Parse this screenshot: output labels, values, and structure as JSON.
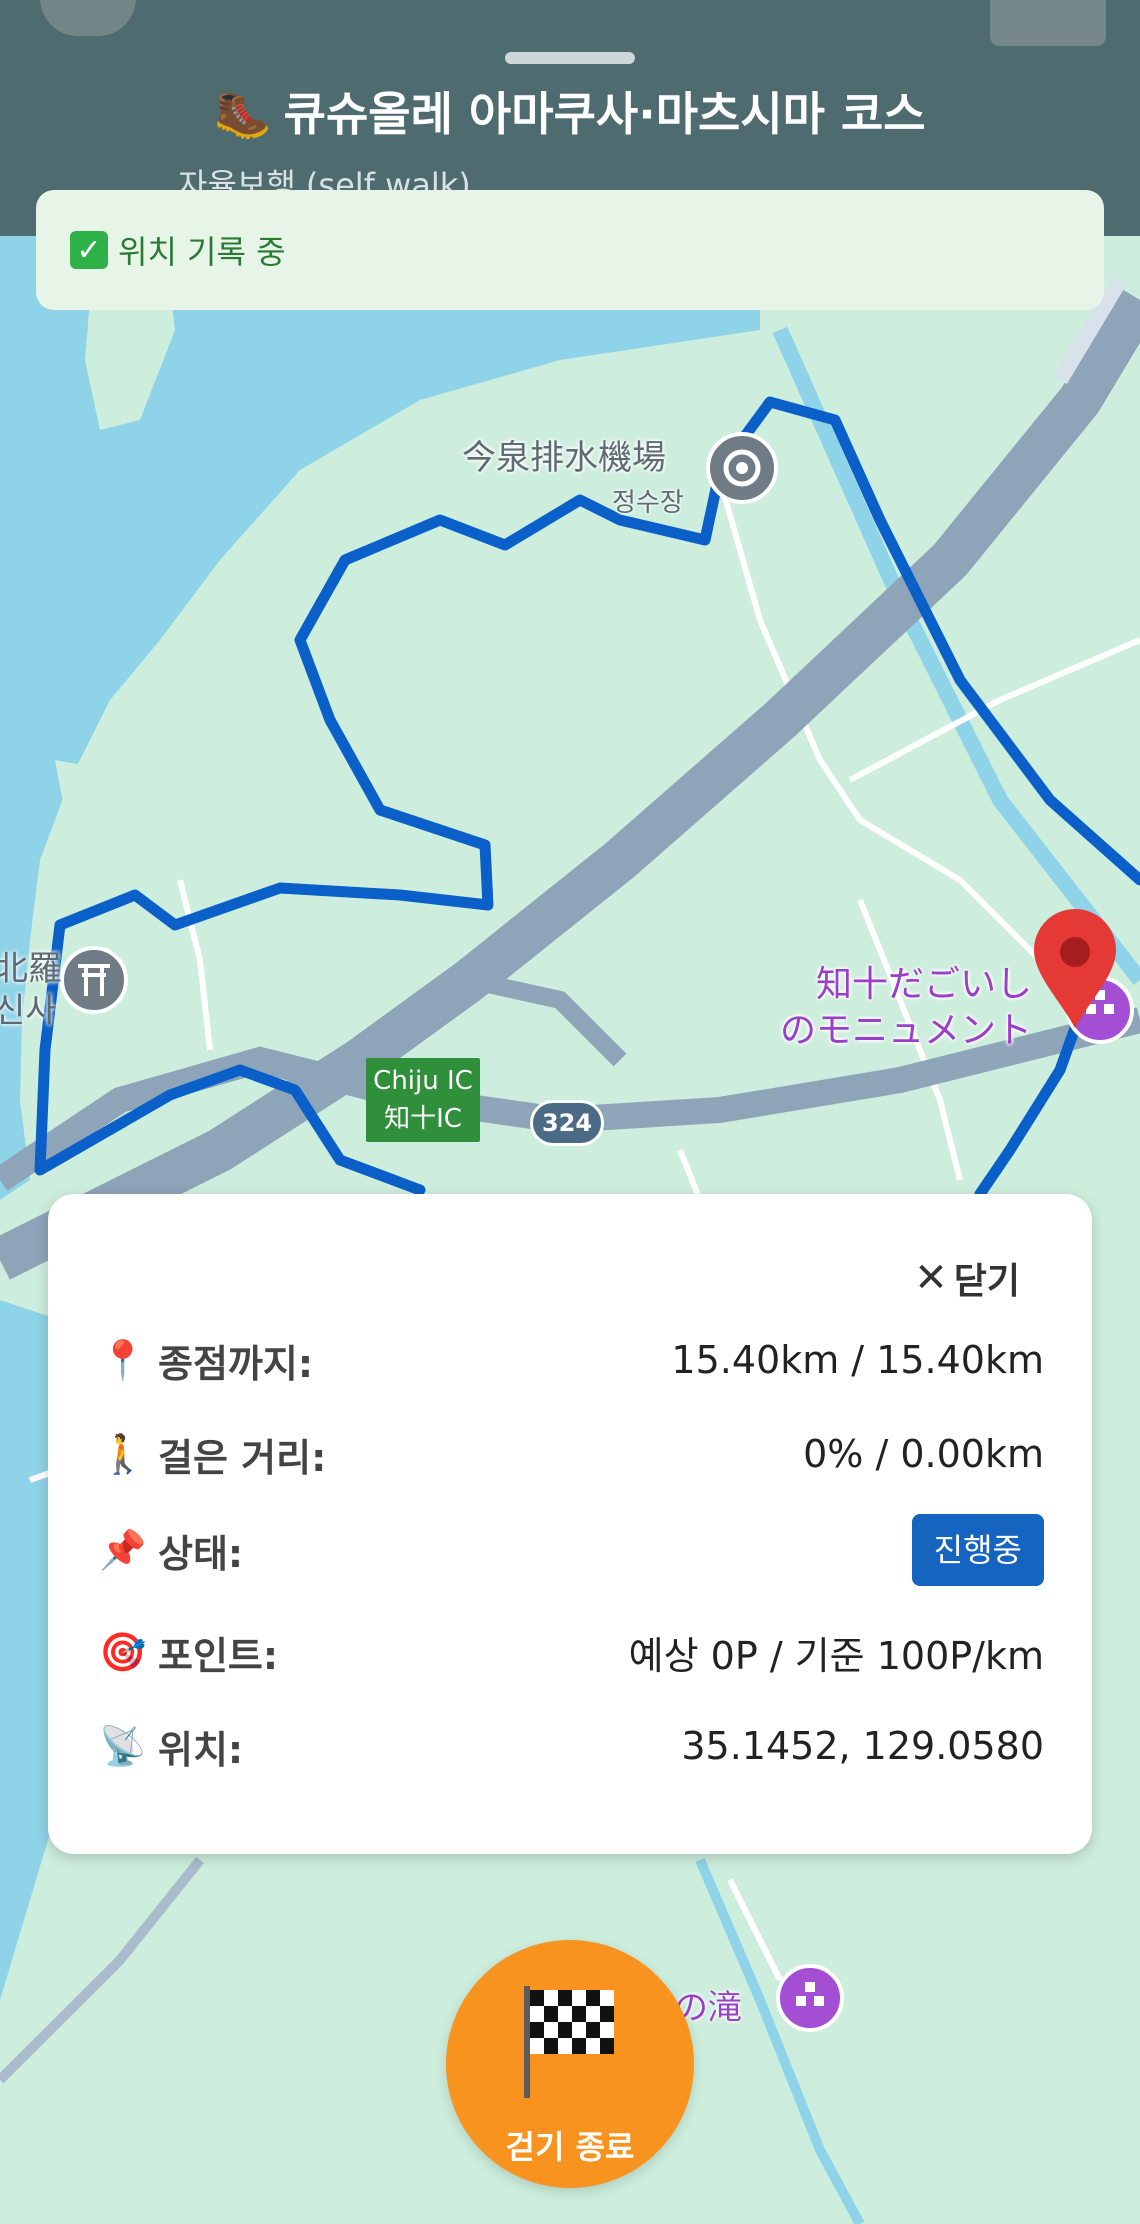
{
  "header": {
    "title": "큐슈올레 아마쿠사·마츠시마 코스",
    "subtitle": "자율보행 (self walk)",
    "title_icon": "boot-icon"
  },
  "status_banner": {
    "text": "위치 기록 중",
    "icon": "check-box-icon"
  },
  "map": {
    "labels": {
      "pumping_station": "今泉排水機場",
      "pumping_station_sub": "정수장",
      "monument_line1": "知十だごいし",
      "monument_line2": "のモニュメント",
      "shrine_line1": "北羅",
      "shrine_line2": "신사",
      "ic_line1": "Chiju IC",
      "ic_line2": "知十IC",
      "route_number": "324",
      "waterfall": "水の滝"
    },
    "colors": {
      "water": "#8fd3e8",
      "land": "#cdeedd",
      "road": "#8ea4b8",
      "route": "#0a5fc8",
      "marker": "#e53935"
    }
  },
  "info_card": {
    "close_label": "닫기",
    "rows": [
      {
        "icon": "pin-icon",
        "label": "종점까지:",
        "value": "15.40km / 15.40km"
      },
      {
        "icon": "walker-icon",
        "label": "걸은 거리:",
        "value": "0% / 0.00km"
      },
      {
        "icon": "pushpin-icon",
        "label": "상태:",
        "value": "진행중"
      },
      {
        "icon": "target-icon",
        "label": "포인트:",
        "value": "예상 0P / 기준 100P/km"
      },
      {
        "icon": "satellite-icon",
        "label": "위치:",
        "value": "35.1452, 129.0580"
      }
    ]
  },
  "end_button": {
    "label": "걷기 종료",
    "icon": "checkered-flag-icon",
    "color": "#f7931e"
  }
}
